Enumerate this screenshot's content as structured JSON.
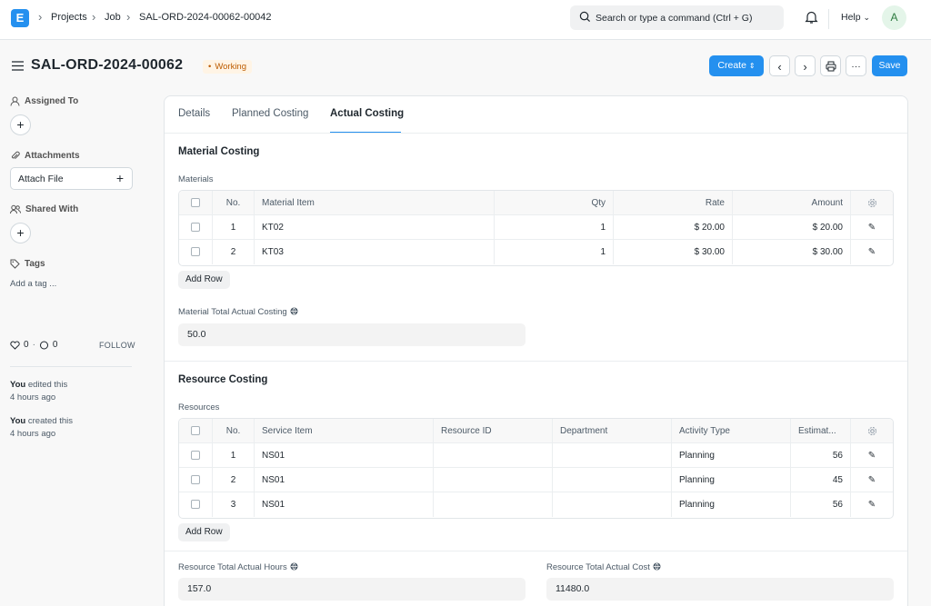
{
  "topbar": {
    "logo": "E",
    "breadcrumbs": [
      "Projects",
      "Job",
      "SAL-ORD-2024-00062-00042"
    ],
    "search_placeholder": "Search or type a command (Ctrl + G)",
    "help": "Help",
    "avatar": "A"
  },
  "doc": {
    "title": "SAL-ORD-2024-00062",
    "status": "Working",
    "create": "Create",
    "save": "Save"
  },
  "sidebar": {
    "assigned_to": "Assigned To",
    "attachments": "Attachments",
    "attach_file": "Attach File",
    "shared_with": "Shared With",
    "tags": "Tags",
    "add_tag": "Add a tag ...",
    "likes": "0",
    "comments": "0",
    "follow": "FOLLOW",
    "activity": [
      {
        "user": "You",
        "action": " edited this",
        "time": "4 hours ago"
      },
      {
        "user": "You",
        "action": " created this",
        "time": "4 hours ago"
      }
    ]
  },
  "tabs": [
    "Details",
    "Planned Costing",
    "Actual Costing"
  ],
  "material": {
    "section_title": "Material Costing",
    "table_label": "Materials",
    "columns": [
      "No.",
      "Material Item",
      "Qty",
      "Rate",
      "Amount"
    ],
    "rows": [
      {
        "no": "1",
        "item": "KT02",
        "qty": "1",
        "rate": "$ 20.00",
        "amount": "$ 20.00"
      },
      {
        "no": "2",
        "item": "KT03",
        "qty": "1",
        "rate": "$ 30.00",
        "amount": "$ 30.00"
      }
    ],
    "add_row": "Add Row",
    "total_label": "Material Total Actual Costing",
    "total_value": "50.0"
  },
  "resource": {
    "section_title": "Resource Costing",
    "table_label": "Resources",
    "columns": [
      "No.",
      "Service Item",
      "Resource ID",
      "Department",
      "Activity Type",
      "Estimat..."
    ],
    "rows": [
      {
        "no": "1",
        "item": "NS01",
        "resource_id": "",
        "department": "",
        "activity": "Planning",
        "estimated": "56"
      },
      {
        "no": "2",
        "item": "NS01",
        "resource_id": "",
        "department": "",
        "activity": "Planning",
        "estimated": "45"
      },
      {
        "no": "3",
        "item": "NS01",
        "resource_id": "",
        "department": "",
        "activity": "Planning",
        "estimated": "56"
      }
    ],
    "add_row": "Add Row",
    "hours_label": "Resource Total Actual Hours",
    "hours_value": "157.0",
    "cost_label": "Resource Total Actual Cost",
    "cost_value": "11480.0"
  },
  "colors": {
    "primary": "#2490ef",
    "status_bg": "#fff4e5",
    "status_text": "#bd5c00"
  }
}
